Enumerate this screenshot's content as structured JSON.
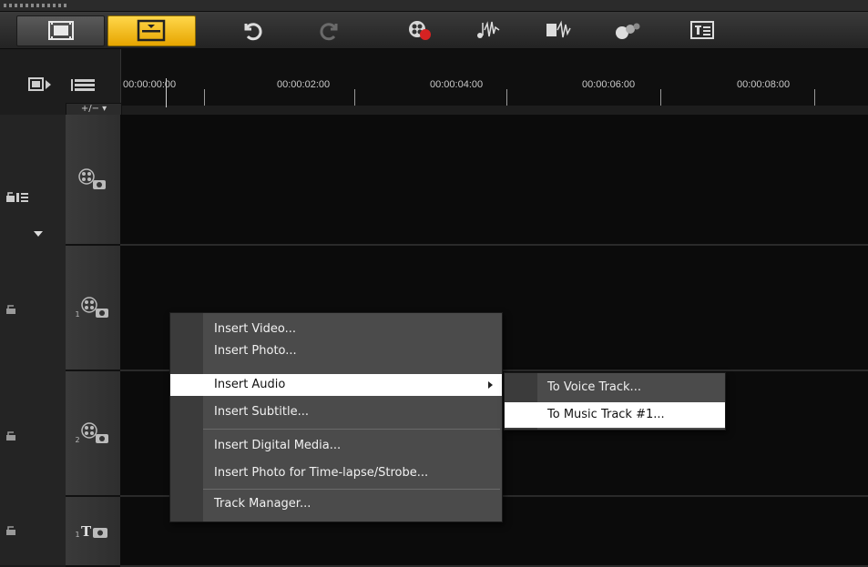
{
  "ruler": {
    "ticks": [
      "00:00:00:00",
      "00:00:02:00",
      "00:00:04:00",
      "00:00:06:00",
      "00:00:08:00"
    ],
    "add_track_label": "+/− ▾"
  },
  "toolbar": {
    "icons": [
      "storyboard-view-icon",
      "timeline-view-icon",
      "undo-icon",
      "redo-icon",
      "record-capture-icon",
      "sound-mixer-icon",
      "auto-music-icon",
      "motion-tracking-icon",
      "subtitle-editor-icon"
    ]
  },
  "context_menu": {
    "items": [
      {
        "label": "Insert Video..."
      },
      {
        "label": "Insert Photo..."
      },
      {
        "label": "Insert Audio"
      },
      {
        "label": "Insert Subtitle..."
      },
      {
        "label": "Insert Digital Media..."
      },
      {
        "label": "Insert Photo for Time-lapse/Strobe..."
      },
      {
        "label": "Track Manager..."
      }
    ],
    "highlighted": "Insert Audio"
  },
  "submenu": {
    "items": [
      {
        "label": "To Voice Track..."
      },
      {
        "label": "To Music Track #1..."
      }
    ],
    "highlighted": "To Music Track #1..."
  },
  "tracks": [
    {
      "name": "video-track",
      "index_label": ""
    },
    {
      "name": "overlay-track-1",
      "index_label": "1"
    },
    {
      "name": "overlay-track-2",
      "index_label": "2"
    },
    {
      "name": "title-track-1",
      "index_label": "1"
    }
  ],
  "colors": {
    "accent": "#f2b800",
    "menu_bg": "#4b4b4b",
    "highlight": "#ffffff"
  }
}
